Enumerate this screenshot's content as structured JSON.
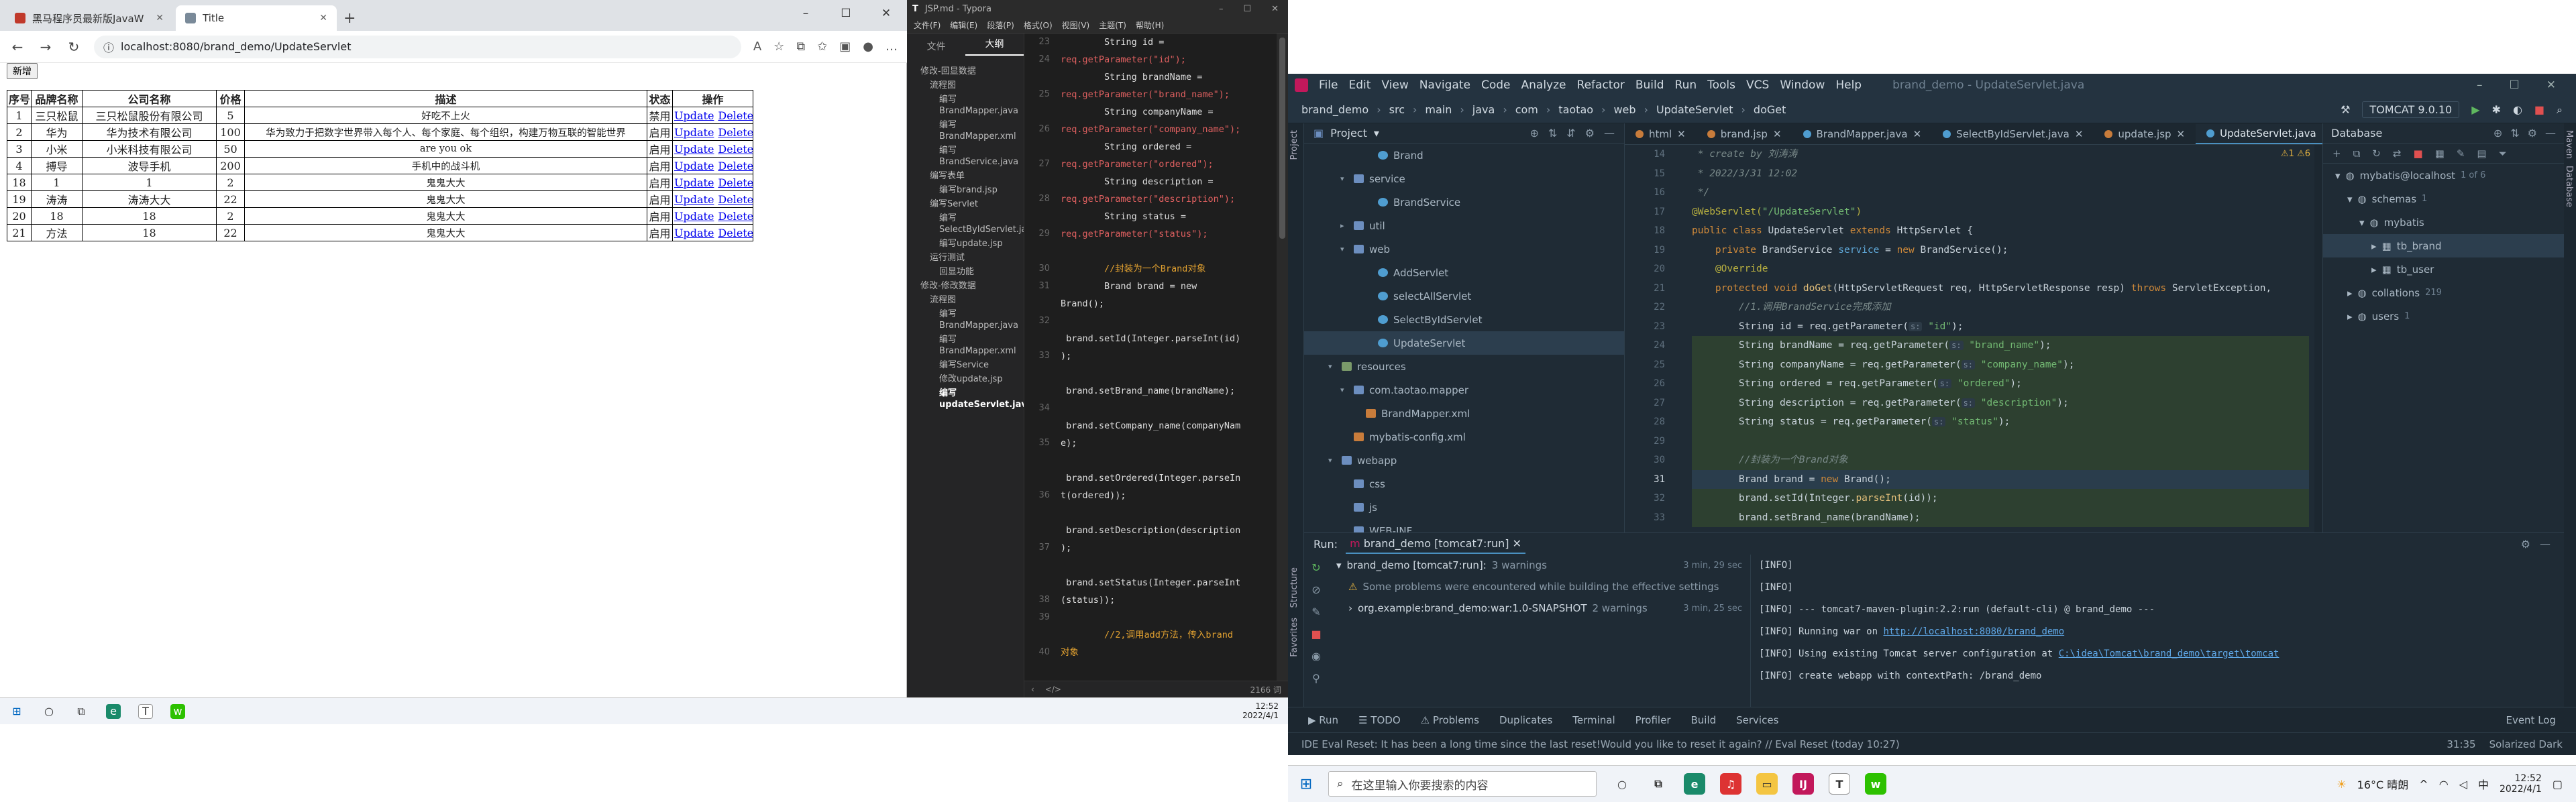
{
  "browser": {
    "tabs": [
      {
        "label": "黑马程序员最新版JavaWeb基础",
        "icon": "bilibili-icon",
        "active": false
      },
      {
        "label": "Title",
        "icon": "page-icon",
        "active": true
      }
    ],
    "url": "localhost:8080/brand_demo/UpdateServlet",
    "add_button": "新增",
    "table": {
      "headers": [
        "序号",
        "品牌名称",
        "公司名称",
        "价格",
        "描述",
        "状态",
        "操作"
      ],
      "rows": [
        [
          "1",
          "三只松鼠",
          "三只松鼠股份有限公司",
          "5",
          "好吃不上火",
          "禁用"
        ],
        [
          "2",
          "华为",
          "华为技术有限公司",
          "100",
          "华为致力于把数字世界带入每个人、每个家庭、每个组织，构建万物互联的智能世界",
          "启用"
        ],
        [
          "3",
          "小米",
          "小米科技有限公司",
          "50",
          "are you ok",
          "启用"
        ],
        [
          "4",
          "搏导",
          "波导手机",
          "200",
          "手机中的战斗机",
          "启用"
        ],
        [
          "18",
          "1",
          "1",
          "2",
          "鬼鬼大大",
          "启用"
        ],
        [
          "19",
          "涛涛",
          "涛涛大大",
          "22",
          "鬼鬼大大",
          "启用"
        ],
        [
          "20",
          "18",
          "18",
          "2",
          "鬼鬼大大",
          "启用"
        ],
        [
          "21",
          "方法",
          "18",
          "22",
          "鬼鬼大大",
          "启用"
        ]
      ],
      "update_link": "Update",
      "delete_link": "Delete"
    }
  },
  "taskbar_left": {
    "time": "12:52",
    "date": "2022/4/1"
  },
  "typora": {
    "title": "JSP.md - Typora",
    "menu": [
      "文件(F)",
      "编辑(E)",
      "段落(P)",
      "格式(O)",
      "视图(V)",
      "主题(T)",
      "帮助(H)"
    ],
    "side_tabs": [
      "文件",
      "大纲"
    ],
    "outline": [
      {
        "text": "修改-回显数据",
        "lvl": 1,
        "cur": false
      },
      {
        "text": "流程图",
        "lvl": 2,
        "cur": false
      },
      {
        "text": "编写BrandMapper.java",
        "lvl": 3,
        "cur": false
      },
      {
        "text": "编写BrandMapper.xml",
        "lvl": 3,
        "cur": false
      },
      {
        "text": "编写BrandService.java",
        "lvl": 3,
        "cur": false
      },
      {
        "text": "编写表单",
        "lvl": 2,
        "cur": false
      },
      {
        "text": "编写brand.jsp",
        "lvl": 3,
        "cur": false
      },
      {
        "text": "编写Servlet",
        "lvl": 2,
        "cur": false
      },
      {
        "text": "编写SelectByIdServlet.java",
        "lvl": 3,
        "cur": false
      },
      {
        "text": "编写update.jsp",
        "lvl": 3,
        "cur": false
      },
      {
        "text": "运行测试",
        "lvl": 2,
        "cur": false
      },
      {
        "text": "回显功能",
        "lvl": 3,
        "cur": false
      },
      {
        "text": "修改-修改数据",
        "lvl": 1,
        "cur": false
      },
      {
        "text": "流程图",
        "lvl": 2,
        "cur": false
      },
      {
        "text": "编写BrandMapper.java",
        "lvl": 3,
        "cur": false
      },
      {
        "text": "编写BrandMapper.xml",
        "lvl": 3,
        "cur": false
      },
      {
        "text": "编写Service",
        "lvl": 3,
        "cur": false
      },
      {
        "text": "修改update.jsp",
        "lvl": 3,
        "cur": false
      },
      {
        "text": "编写updateServlet.java",
        "lvl": 3,
        "cur": true
      }
    ],
    "gutter": [
      "23",
      "24",
      "",
      "25",
      "",
      "26",
      "",
      "27",
      "",
      "28",
      "",
      "29",
      "",
      "30",
      "31",
      "",
      "32",
      "",
      "33",
      "",
      "",
      "34",
      "",
      "35",
      "",
      "",
      "36",
      "",
      "",
      "37",
      "",
      "",
      "38",
      "39",
      "",
      "40"
    ],
    "status_words": "2166 词"
  },
  "ide": {
    "menu": [
      "File",
      "Edit",
      "View",
      "Navigate",
      "Code",
      "Analyze",
      "Refactor",
      "Build",
      "Run",
      "Tools",
      "VCS",
      "Window",
      "Help"
    ],
    "window_title": "brand_demo - UpdateServlet.java",
    "breadcrumb": [
      "brand_demo",
      "src",
      "main",
      "java",
      "com",
      "taotao",
      "web",
      "UpdateServlet",
      "doGet"
    ],
    "run_config": "TOMCAT 9.0.10",
    "project_label": "Project",
    "project_tree": [
      {
        "label": "Brand",
        "indent": 5,
        "type": "java",
        "arrow": "",
        "sel": false
      },
      {
        "label": "service",
        "indent": 3,
        "type": "folder",
        "arrow": "▾",
        "sel": false
      },
      {
        "label": "BrandService",
        "indent": 5,
        "type": "java",
        "arrow": "",
        "sel": false
      },
      {
        "label": "util",
        "indent": 3,
        "type": "folder",
        "arrow": "▸",
        "sel": false
      },
      {
        "label": "web",
        "indent": 3,
        "type": "folder",
        "arrow": "▾",
        "sel": false
      },
      {
        "label": "AddServlet",
        "indent": 5,
        "type": "java",
        "arrow": "",
        "sel": false
      },
      {
        "label": "selectAllServlet",
        "indent": 5,
        "type": "java",
        "arrow": "",
        "sel": false
      },
      {
        "label": "SelectByIdServlet",
        "indent": 5,
        "type": "java",
        "arrow": "",
        "sel": false
      },
      {
        "label": "UpdateServlet",
        "indent": 5,
        "type": "java",
        "arrow": "",
        "sel": true
      },
      {
        "label": "resources",
        "indent": 2,
        "type": "res",
        "arrow": "▾",
        "sel": false
      },
      {
        "label": "com.taotao.mapper",
        "indent": 3,
        "type": "folder",
        "arrow": "▾",
        "sel": false
      },
      {
        "label": "BrandMapper.xml",
        "indent": 4,
        "type": "xml",
        "arrow": "",
        "sel": false
      },
      {
        "label": "mybatis-config.xml",
        "indent": 3,
        "type": "xml",
        "arrow": "",
        "sel": false
      },
      {
        "label": "webapp",
        "indent": 2,
        "type": "folder",
        "arrow": "▾",
        "sel": false
      },
      {
        "label": "css",
        "indent": 3,
        "type": "folder",
        "arrow": "",
        "sel": false
      },
      {
        "label": "js",
        "indent": 3,
        "type": "folder",
        "arrow": "",
        "sel": false
      },
      {
        "label": "WEB-INF",
        "indent": 3,
        "type": "folder",
        "arrow": "",
        "sel": false
      }
    ],
    "editor_tabs": [
      {
        "label": "html",
        "type": "jsp",
        "on": false
      },
      {
        "label": "brand.jsp",
        "type": "jsp",
        "on": false
      },
      {
        "label": "BrandMapper.java",
        "type": "java",
        "on": false
      },
      {
        "label": "SelectByIdServlet.java",
        "type": "java",
        "on": false
      },
      {
        "label": "update.jsp",
        "type": "jsp",
        "on": false
      },
      {
        "label": "UpdateServlet.java",
        "type": "java",
        "on": true
      }
    ],
    "editor_warn": "⚠1 ⚠6",
    "line_numbers": [
      "14",
      "15",
      "16",
      "17",
      "18",
      "19",
      "20",
      "21",
      "22",
      "23",
      "24",
      "25",
      "26",
      "27",
      "28",
      "29",
      "30",
      "31",
      "32",
      "33"
    ],
    "current_line": "31",
    "code_lines": [
      [
        {
          "t": " * create by 刘涛涛",
          "c": "j-cm"
        }
      ],
      [
        {
          "t": " * 2022/3/31 12:02",
          "c": "j-cm"
        }
      ],
      [
        {
          "t": " */",
          "c": "j-cm"
        }
      ],
      [
        {
          "t": "@WebServlet(",
          "c": "j-an"
        },
        {
          "t": "\"/UpdateServlet\"",
          "c": "j-str"
        },
        {
          "t": ")",
          "c": "j-an"
        }
      ],
      [
        {
          "t": "public class ",
          "c": "j-kw"
        },
        {
          "t": "UpdateServlet ",
          "c": ""
        },
        {
          "t": "extends ",
          "c": "j-kw"
        },
        {
          "t": "HttpServlet {",
          "c": ""
        }
      ],
      [
        {
          "t": "    private ",
          "c": "j-kw"
        },
        {
          "t": "BrandService ",
          "c": ""
        },
        {
          "t": "service",
          "c": "j-cls"
        },
        {
          "t": " = ",
          "c": ""
        },
        {
          "t": "new ",
          "c": "j-kw"
        },
        {
          "t": "BrandService();",
          "c": ""
        }
      ],
      [
        {
          "t": "    @Override",
          "c": "j-an"
        }
      ],
      [
        {
          "t": "    protected void ",
          "c": "j-kw"
        },
        {
          "t": "doGet",
          "c": "j-fn"
        },
        {
          "t": "(HttpServletRequest req, HttpServletResponse resp) ",
          "c": ""
        },
        {
          "t": "throws ",
          "c": "j-kw"
        },
        {
          "t": "ServletException,",
          "c": ""
        }
      ],
      [
        {
          "t": "        //1.调用BrandService完成添加",
          "c": "j-cm"
        }
      ],
      [
        {
          "t": "        String id = req.getParameter(",
          "c": ""
        },
        {
          "t": "s:",
          "c": "j-hint"
        },
        {
          "t": " \"id\"",
          "c": "j-str"
        },
        {
          "t": ");",
          "c": ""
        }
      ],
      [
        {
          "t": "        String brandName = req.getParameter(",
          "c": ""
        },
        {
          "t": "s:",
          "c": "j-hint"
        },
        {
          "t": " \"brand_name\"",
          "c": "j-str"
        },
        {
          "t": ");",
          "c": ""
        }
      ],
      [
        {
          "t": "        String companyName = req.getParameter(",
          "c": ""
        },
        {
          "t": "s:",
          "c": "j-hint"
        },
        {
          "t": " \"company_name\"",
          "c": "j-str"
        },
        {
          "t": ");",
          "c": ""
        }
      ],
      [
        {
          "t": "        String ordered = req.getParameter(",
          "c": ""
        },
        {
          "t": "s:",
          "c": "j-hint"
        },
        {
          "t": " \"ordered\"",
          "c": "j-str"
        },
        {
          "t": ");",
          "c": ""
        }
      ],
      [
        {
          "t": "        String description = req.getParameter(",
          "c": ""
        },
        {
          "t": "s:",
          "c": "j-hint"
        },
        {
          "t": " \"description\"",
          "c": "j-str"
        },
        {
          "t": ");",
          "c": ""
        }
      ],
      [
        {
          "t": "        String status = req.getParameter(",
          "c": ""
        },
        {
          "t": "s:",
          "c": "j-hint"
        },
        {
          "t": " \"status\"",
          "c": "j-str"
        },
        {
          "t": ");",
          "c": ""
        }
      ],
      [
        {
          "t": "",
          "c": ""
        }
      ],
      [
        {
          "t": "        //封装为一个Brand对象",
          "c": "j-cm"
        }
      ],
      [
        {
          "t": "        Brand brand = ",
          "c": ""
        },
        {
          "t": "new ",
          "c": "j-kw"
        },
        {
          "t": "Brand();",
          "c": ""
        }
      ],
      [
        {
          "t": "        brand.setId(Integer.",
          "c": ""
        },
        {
          "t": "parseInt",
          "c": "j-fn"
        },
        {
          "t": "(id));",
          "c": ""
        }
      ],
      [
        {
          "t": "        brand.setBrand_name(brandName);",
          "c": ""
        }
      ]
    ],
    "highlight_from": 10,
    "db": {
      "title": "Database",
      "items": [
        {
          "label": "mybatis@localhost",
          "count": "1 of 6",
          "indent": 1,
          "arrow": "▾",
          "sel": false
        },
        {
          "label": "schemas",
          "count": "1",
          "indent": 2,
          "arrow": "▾",
          "sel": false
        },
        {
          "label": "mybatis",
          "count": "",
          "indent": 3,
          "arrow": "▾",
          "sel": false
        },
        {
          "label": "tb_brand",
          "count": "",
          "indent": 4,
          "arrow": "▸",
          "sel": true
        },
        {
          "label": "tb_user",
          "count": "",
          "indent": 4,
          "arrow": "▸",
          "sel": false
        },
        {
          "label": "collations",
          "count": "219",
          "indent": 2,
          "arrow": "▸",
          "sel": false
        },
        {
          "label": "users",
          "count": "1",
          "indent": 2,
          "arrow": "▸",
          "sel": false
        }
      ]
    },
    "run": {
      "label": "Run:",
      "tab": "brand_demo [tomcat7:run]",
      "tree": [
        {
          "label": "brand_demo [tomcat7:run]:",
          "extra": " 3 warnings",
          "meta": "3 min, 29 sec",
          "warn": false
        },
        {
          "label": "Some problems were encountered while building the effective settings",
          "extra": "",
          "meta": "",
          "warn": true
        },
        {
          "label": "org.example:brand_demo:war:1.0-SNAPSHOT",
          "extra": " 2 warnings",
          "meta": "3 min, 25 sec",
          "warn": false
        }
      ],
      "log": [
        {
          "text": "[INFO]",
          "link": ""
        },
        {
          "text": "[INFO]",
          "link": ""
        },
        {
          "text": "[INFO] --- tomcat7-maven-plugin:2.2:run (default-cli) @ brand_demo ---",
          "link": ""
        },
        {
          "text": "[INFO] Running war on ",
          "link": "http://localhost:8080/brand_demo"
        },
        {
          "text": "[INFO] Using existing Tomcat server configuration at ",
          "link": "C:\\idea\\Tomcat\\brand_demo\\target\\tomcat"
        },
        {
          "text": "[INFO] create webapp with contextPath: /brand_demo",
          "link": ""
        }
      ]
    },
    "bottom_tabs": [
      "▶ Run",
      "☰ TODO",
      "⚠ Problems",
      "Duplicates",
      "Terminal",
      "Profiler",
      "Build",
      "Services"
    ],
    "event_log": "Event Log",
    "status_msg": "IDE Eval Reset: It has been a long time since the last reset!Would you like to reset it again? // Eval Reset (today 10:27)",
    "status_pos": "31:35",
    "status_theme": "Solarized Dark"
  },
  "taskbar_right": {
    "search_placeholder": "在这里输入你要搜索的内容",
    "weather": "16°C 晴朗",
    "time": "12:52",
    "date": "2022/4/1"
  }
}
